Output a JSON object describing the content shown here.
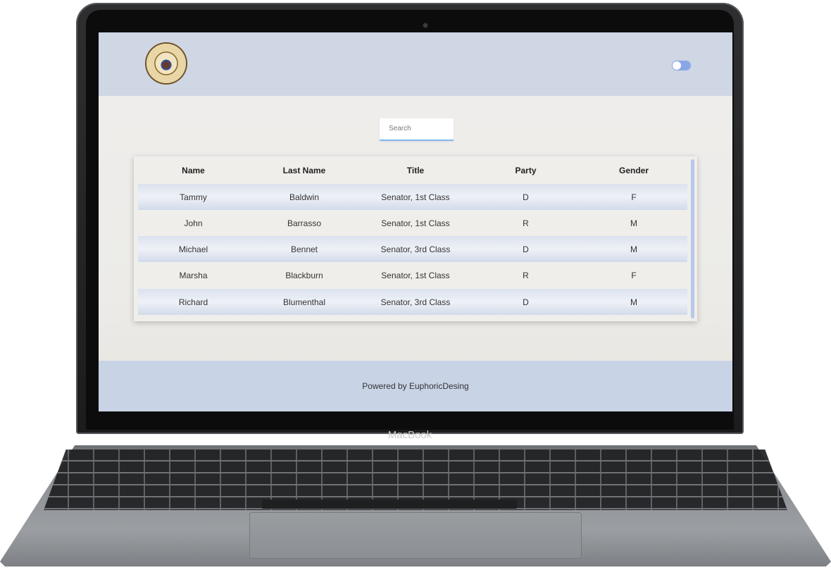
{
  "device": {
    "brand_label": "MacBook"
  },
  "header": {
    "logo_name": "united-states-congress-seal",
    "toggle_state": "off"
  },
  "search": {
    "placeholder": "Search"
  },
  "table": {
    "columns": [
      "Name",
      "Last Name",
      "Title",
      "Party",
      "Gender"
    ],
    "rows": [
      [
        "Tammy",
        "Baldwin",
        "Senator, 1st Class",
        "D",
        "F"
      ],
      [
        "John",
        "Barrasso",
        "Senator, 1st Class",
        "R",
        "M"
      ],
      [
        "Michael",
        "Bennet",
        "Senator, 3rd Class",
        "D",
        "M"
      ],
      [
        "Marsha",
        "Blackburn",
        "Senator, 1st Class",
        "R",
        "F"
      ],
      [
        "Richard",
        "Blumenthal",
        "Senator, 3rd Class",
        "D",
        "M"
      ]
    ]
  },
  "footer": {
    "text": "Powered by EuphoricDesing"
  },
  "colors": {
    "header_bg": "#cfd6e4",
    "footer_bg": "#c9d3e6",
    "toggle": "#8aa6e6",
    "search_underline": "#7db8f2",
    "row_stripe": "#dbe2ee"
  }
}
